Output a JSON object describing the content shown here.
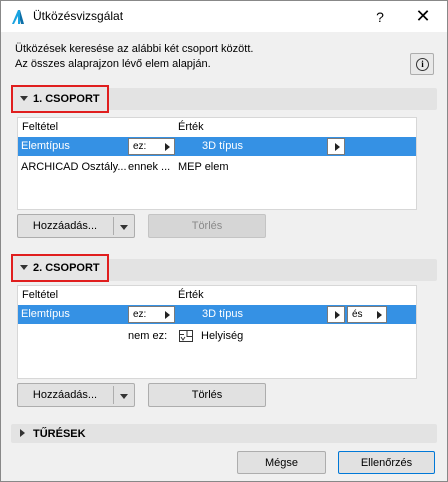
{
  "window": {
    "title": "Ütközésvizsgálat",
    "help_label": "?",
    "close_label": "✕"
  },
  "intro": {
    "line1": "Ütközések keresése az alábbi két csoport között.",
    "line2": "Az összes alaprajzon lévő elem alapján.",
    "info_label": "i"
  },
  "group1": {
    "title": "1. CSOPORT",
    "headers": {
      "condition": "Feltétel",
      "value": "Érték"
    },
    "rows": [
      {
        "condition": "Elemtípus",
        "operator": "ez:",
        "value": "3D típus"
      },
      {
        "condition": "ARCHICAD Osztály...",
        "operator": "ennek ...",
        "value": "MEP elem"
      }
    ],
    "add_label": "Hozzáadás...",
    "delete_label": "Törlés"
  },
  "group2": {
    "title": "2. CSOPORT",
    "headers": {
      "condition": "Feltétel",
      "value": "Érték"
    },
    "rows": [
      {
        "condition": "Elemtípus",
        "operator": "ez:",
        "value": "3D típus",
        "logic": "és"
      },
      {
        "condition": "",
        "operator": "nem ez:",
        "value": "Helyiség"
      }
    ],
    "add_label": "Hozzáadás...",
    "delete_label": "Törlés"
  },
  "tolerances": {
    "title": "TŰRÉSEK"
  },
  "footer": {
    "cancel_label": "Mégse",
    "check_label": "Ellenőrzés"
  },
  "colors": {
    "selection": "#3591e4",
    "highlight_border": "#e01e1e",
    "app_icon": "#1aa3e0"
  }
}
